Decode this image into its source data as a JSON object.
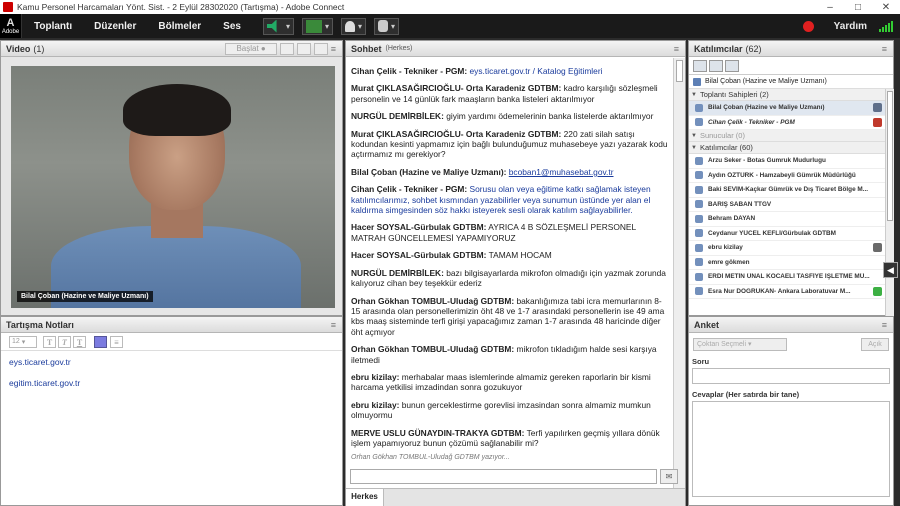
{
  "window": {
    "title": "Kamu Personel Harcamaları Yönt. Sist. - 2 Eylül 28302020 (Tartışma) - Adobe Connect"
  },
  "menubar": {
    "logo": "Adobe",
    "items": [
      "Toplantı",
      "Düzenler",
      "Bölmeler",
      "Ses"
    ],
    "help": "Yardım"
  },
  "video": {
    "title": "Video",
    "count": "(1)",
    "start_label": "Başlat",
    "presenter_name": "Bilal Çoban (Hazine ve Maliye Uzmanı)"
  },
  "notes": {
    "title": "Tartışma Notları",
    "font_size": "12",
    "lines": [
      "eys.ticaret.gov.tr",
      "egitim.ticaret.gov.tr"
    ]
  },
  "chat": {
    "title": "Sohbet",
    "subtitle": "(Herkes)",
    "typing": "Orhan Gökhan TOMBUL-Uludağ GDTBM yazıyor...",
    "tab": "Herkes",
    "messages": [
      {
        "sender": "Cihan Çelik - Tekniker - PGM:",
        "text": "eys.ticaret.gov.tr / Katalog Eğitimleri",
        "style": "lnk"
      },
      {
        "sender": "Murat ÇIKLASAĞIRCIOĞLU- Orta Karadeniz GDTBM:",
        "text": "kadro karşılığı sözleşmeli personelin ve 14 günlük fark maaşların banka listeleri aktarılmıyor",
        "style": ""
      },
      {
        "sender": "NURGÜL DEMİRBİLEK:",
        "text": "giyim yardımı ödemelerinin banka listelerde aktarılmıyor",
        "style": ""
      },
      {
        "sender": "Murat ÇIKLASAĞIRCIOĞLU- Orta Karadeniz GDTBM:",
        "text": "220 zati silah satışı kodundan kesinti yapmamız için bağlı bulunduğumuz muhasebeye yazı yazarak kodu açtırmamız mı gerekiyor?",
        "style": ""
      },
      {
        "sender": "Bilal Çoban (Hazine ve Maliye Uzmanı):",
        "text": "bcoban1@muhasebat.gov.tr",
        "style": "ul"
      },
      {
        "sender": "Cihan Çelik - Tekniker - PGM:",
        "text": "Sorusu olan veya eğitime katkı sağlamak isteyen katılımcılarımız, sohbet kısmından yazabilirler veya sunumun üstünde yer alan el kaldırma simgesinden söz hakkı isteyerek sesli olarak katılım sağlayabilirler.",
        "style": "hl"
      },
      {
        "sender": "Hacer SOYSAL-Gürbulak GDTBM:",
        "text": "AYRICA 4 B SÖZLEŞMELİ PERSONEL MATRAH GÜNCELLEMESİ YAPAMIYORUZ",
        "style": ""
      },
      {
        "sender": "Hacer SOYSAL-Gürbulak GDTBM:",
        "text": "TAMAM HOCAM",
        "style": ""
      },
      {
        "sender": "NURGÜL DEMİRBİLEK:",
        "text": "bazı bilgisayarlarda mikrofon olmadığı için yazmak zorunda kalıyoruz cihan bey teşekkür ederiz",
        "style": ""
      },
      {
        "sender": "Orhan Gökhan TOMBUL-Uludağ GDTBM:",
        "text": "bakanlığımıza tabi icra memurlarının 8-15 arasında olan personellerimizin öht 48 ve 1-7 arasındaki personellerin ise 49 ama kbs maaş sisteminde terfi girişi yapacağımız zaman 1-7 arasında 48 haricinde diğer öht açmıyor",
        "style": ""
      },
      {
        "sender": "Orhan Gökhan TOMBUL-Uludağ GDTBM:",
        "text": "mikrofon tıkladığım halde sesi karşıya iletmedi",
        "style": ""
      },
      {
        "sender": "ebru kizilay:",
        "text": "merhabalar maas islemlerinde almamiz gereken raporlarin bir kismi harcama yetkilisi imzadindan sonra gozukuyor",
        "style": ""
      },
      {
        "sender": "ebru kizilay:",
        "text": "bunun gerceklestirme gorevlisi imzasindan sonra almamiz mumkun olmuyormu",
        "style": ""
      },
      {
        "sender": "MERVE USLU GÜNAYDIN-TRAKYA GDTBM:",
        "text": "Terfi yapılırken geçmiş yıllara dönük işlem yapamıyoruz bunun çözümü sağlanabilir mi?",
        "style": ""
      }
    ]
  },
  "attendees": {
    "title": "Katılımcılar",
    "count": "(62)",
    "me": "Bilal Çoban (Hazine ve Maliye Uzmanı)",
    "hosts_group": "Toplantı Sahipleri (2)",
    "hosts": [
      {
        "name": "Bilal Çoban (Hazine ve Maliye Uzmanı)",
        "italic": false,
        "status": "#5f6f8a",
        "highlight": true
      },
      {
        "name": "Cihan Çelik - Tekniker - PGM",
        "italic": true,
        "status": "#c0392b",
        "highlight": false
      }
    ],
    "presenters_group": "Sunucular (0)",
    "participants_group": "Katılımcılar (60)",
    "participants": [
      {
        "name": "Arzu Seker - Botas Gumruk Mudurlugu",
        "status": ""
      },
      {
        "name": "Aydın ÖZTÜRK - Hamzabeyli Gümrük Müdürlüğü",
        "status": ""
      },
      {
        "name": "Baki SEVİM-Kaçkar Gümrük ve Dış Ticaret Bölge M...",
        "status": ""
      },
      {
        "name": "BARIŞ SABAN TTGV",
        "status": ""
      },
      {
        "name": "Behram DAYAN",
        "status": ""
      },
      {
        "name": "Ceydanur YÜCEL KEFLİ/Gürbulak GDTBM",
        "status": ""
      },
      {
        "name": "ebru kizilay",
        "status": "#6a6a6a"
      },
      {
        "name": "emre gökmen",
        "status": ""
      },
      {
        "name": "ERDİ METİN ÜNAL KOCAELİ TASFİYE İŞLETME MÜ...",
        "status": ""
      },
      {
        "name": "Esra Nur DOĞRUKAN- Ankara Laboratuvar M...",
        "status": "#3cb043"
      }
    ]
  },
  "poll": {
    "title": "Anket",
    "select_placeholder": "Çoktan Seçmeli",
    "action": "Açık",
    "question_label": "Soru",
    "answers_label": "Cevaplar (Her satırda bir tane)"
  }
}
